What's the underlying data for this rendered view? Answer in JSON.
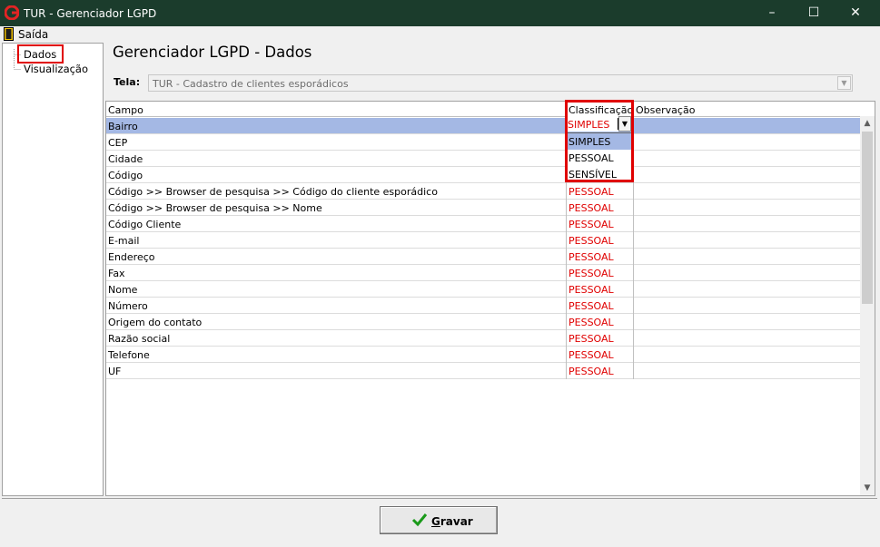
{
  "window": {
    "title": "TUR - Gerenciador LGPD",
    "minimize_glyph": "–",
    "maximize_glyph": "☐",
    "close_glyph": "✕"
  },
  "menu": {
    "exit_label": "Saída"
  },
  "tree": {
    "items": [
      {
        "label": "Dados"
      },
      {
        "label": "Visualização"
      }
    ]
  },
  "page": {
    "heading": "Gerenciador LGPD - Dados",
    "tela_label": "Tela:",
    "tela_value": "TUR - Cadastro de clientes esporádicos"
  },
  "grid": {
    "columns": {
      "campo": "Campo",
      "classificacao": "Classificação",
      "observacao": "Observação"
    },
    "rows": [
      {
        "campo": "Bairro",
        "classificacao": "",
        "observacao": ""
      },
      {
        "campo": "CEP",
        "classificacao": "",
        "observacao": ""
      },
      {
        "campo": "Cidade",
        "classificacao": "",
        "observacao": ""
      },
      {
        "campo": "Código",
        "classificacao": "",
        "observacao": ""
      },
      {
        "campo": "Código >> Browser de pesquisa >> Código do cliente esporádico",
        "classificacao": "PESSOAL",
        "observacao": ""
      },
      {
        "campo": "Código >> Browser de pesquisa >> Nome",
        "classificacao": "PESSOAL",
        "observacao": ""
      },
      {
        "campo": "Código Cliente",
        "classificacao": "PESSOAL",
        "observacao": ""
      },
      {
        "campo": "E-mail",
        "classificacao": "PESSOAL",
        "observacao": ""
      },
      {
        "campo": "Endereço",
        "classificacao": "PESSOAL",
        "observacao": ""
      },
      {
        "campo": "Fax",
        "classificacao": "PESSOAL",
        "observacao": ""
      },
      {
        "campo": "Nome",
        "classificacao": "PESSOAL",
        "observacao": ""
      },
      {
        "campo": "Número",
        "classificacao": "PESSOAL",
        "observacao": ""
      },
      {
        "campo": "Origem do contato",
        "classificacao": "PESSOAL",
        "observacao": ""
      },
      {
        "campo": "Razão social",
        "classificacao": "PESSOAL",
        "observacao": ""
      },
      {
        "campo": "Telefone",
        "classificacao": "PESSOAL",
        "observacao": ""
      },
      {
        "campo": "UF",
        "classificacao": "PESSOAL",
        "observacao": ""
      }
    ],
    "editor_value": "SIMPLES",
    "dropdown_options": [
      "SIMPLES",
      "PESSOAL",
      "SENSÍVEL"
    ]
  },
  "footer": {
    "save_prefix": "",
    "save_mnemonic": "G",
    "save_rest": "ravar"
  },
  "colors": {
    "titlebar": "#1b3c2c",
    "highlight": "#e00000",
    "selection": "#a4b8e4",
    "classification_text": "#e00000"
  },
  "icons": {
    "app": "app-logo-icon",
    "exit": "exit-door-icon",
    "save": "check-icon",
    "dropdown": "dropdown-arrow-icon"
  }
}
